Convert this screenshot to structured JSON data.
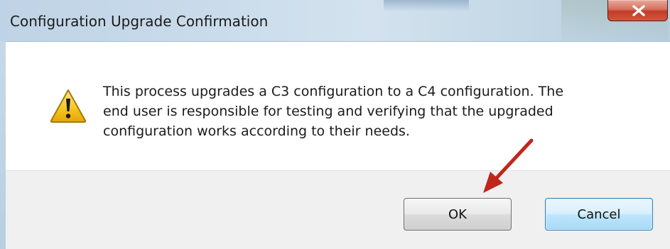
{
  "window": {
    "title": "Configuration Upgrade Confirmation"
  },
  "titlebar_buttons": {
    "close": {
      "icon": "close-icon",
      "glyph": "X"
    }
  },
  "dialog": {
    "icon": "warning-icon",
    "message_lines": [
      "This process upgrades a C3 configuration to a C4 configuration.  The",
      "end user is responsible for testing and verifying that the upgraded",
      "configuration works according to their needs."
    ]
  },
  "buttons": {
    "ok_label": "OK",
    "cancel_label": "Cancel"
  },
  "annotation": {
    "arrow_icon": "red-arrow-icon",
    "color": "#c0261c"
  },
  "colors": {
    "close_button": "#c93b26",
    "warning_yellow": "#f4c51e",
    "cancel_focus_border": "#3c7fb1"
  }
}
